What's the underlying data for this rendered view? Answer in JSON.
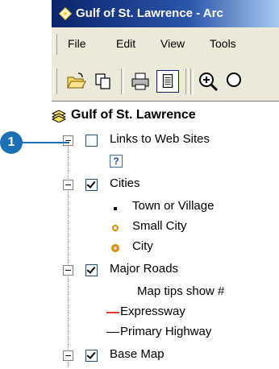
{
  "window": {
    "title": "Gulf of St. Lawrence - Arc"
  },
  "menubar": {
    "items": [
      "File",
      "Edit",
      "View",
      "Tools"
    ]
  },
  "toolbar": {
    "icons": [
      "open-folder-icon",
      "copy-icon",
      "print-icon",
      "table-of-contents-icon",
      "zoom-in-icon"
    ]
  },
  "toc": {
    "title": "Gulf of St. Lawrence",
    "layers": [
      {
        "label": "Links to Web Sites",
        "checked": false
      },
      {
        "label": "Cities",
        "checked": true,
        "legend": [
          "Town or Village",
          "Small City",
          "City"
        ]
      },
      {
        "label": "Major Roads",
        "checked": true,
        "legend": [
          "Map tips show #",
          "Expressway",
          "Primary Highway"
        ]
      },
      {
        "label": "Base Map",
        "checked": true
      }
    ],
    "help_badge": "?"
  },
  "callout": {
    "number": "1"
  },
  "colors": {
    "accent": "#1a6fb5",
    "expressway": "#d93a2b",
    "city": "#e28a00"
  }
}
